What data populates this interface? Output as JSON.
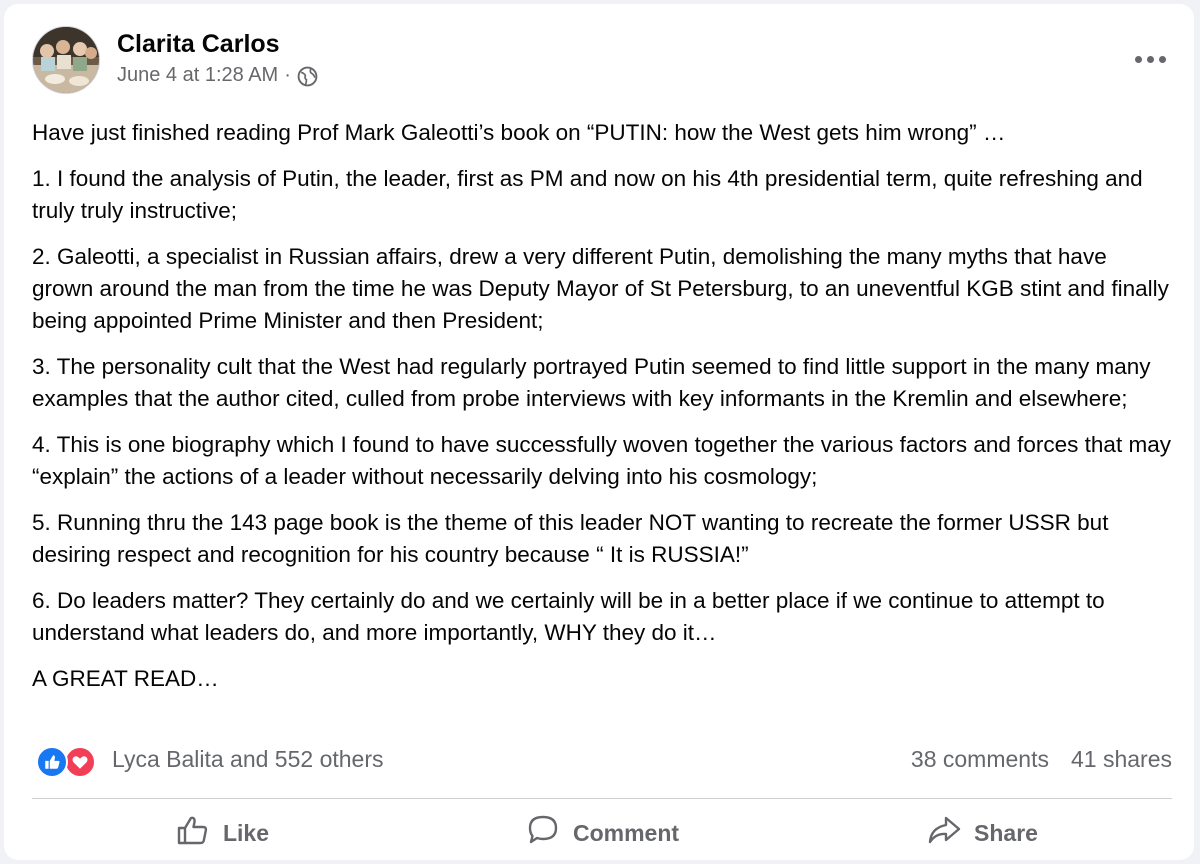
{
  "post": {
    "author": "Clarita Carlos",
    "timestamp": "June 4 at 1:28 AM",
    "separator": "·",
    "privacy_icon": "globe-icon",
    "more_icon": "more-options-icon",
    "paragraphs": [
      "Have just finished reading Prof Mark Galeotti’s book on “PUTIN:  how the West gets him wrong” …",
      "1.  I found the analysis of Putin, the leader, first as PM and now on his 4th presidential term, quite refreshing and truly truly instructive;",
      "2.  Galeotti, a specialist in Russian affairs, drew a very different Putin, demolishing the many myths that have grown around the man from the time he was Deputy Mayor of St Petersburg, to an uneventful KGB stint and finally being appointed Prime Minister and then President;",
      "3.  The personality cult that the West had regularly portrayed Putin seemed to find little support in the many many examples that the author cited, culled from probe interviews with key informants in the Kremlin and elsewhere;",
      "4.  This is one biography which I found to have successfully woven together the various factors and forces that may “explain” the actions of a leader without necessarily delving into his cosmology;",
      "5.  Running thru the 143 page book is the theme of this leader NOT wanting to recreate the former USSR but desiring respect and recognition for his country because “ It is RUSSIA!”",
      "6.  Do leaders matter?  They certainly do and we certainly will be in a better place if we continue to attempt to understand what leaders do, and more importantly, WHY they do it…",
      "A GREAT READ…"
    ]
  },
  "engagement": {
    "reactions_text": "Lyca Balita and 552 others",
    "comments": "38 comments",
    "shares": "41 shares"
  },
  "actions": {
    "like": "Like",
    "comment": "Comment",
    "share": "Share"
  },
  "colors": {
    "like_blue": "#1877f2",
    "love_red": "#f33e58",
    "secondary_text": "#65676b"
  }
}
